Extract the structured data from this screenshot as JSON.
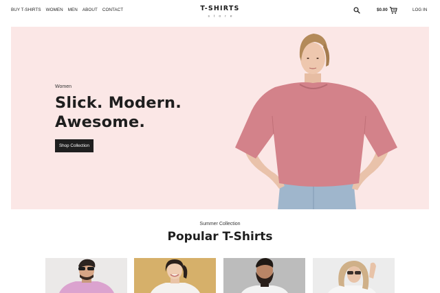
{
  "nav": {
    "items": [
      "BUY T-SHIRTS",
      "WOMEN",
      "MEN",
      "ABOUT",
      "CONTACT"
    ]
  },
  "brand": {
    "name": "T-SHIRTS",
    "tagline": "store"
  },
  "header": {
    "cart_total": "$0.00",
    "login_label": "LOG IN",
    "icons": [
      "search-icon",
      "cart-icon"
    ]
  },
  "hero": {
    "kicker": "Women",
    "title_line1": "Slick. Modern.",
    "title_line2": "Awesome.",
    "button_label": "Shop Collection",
    "background_color": "#fbe7e6"
  },
  "section": {
    "kicker": "Summer Collection",
    "title": "Popular T-Shirts"
  },
  "products": [
    {
      "image": "man-pink-tshirt-sunglasses"
    },
    {
      "image": "woman-white-tshirt-yellow-bg"
    },
    {
      "image": "bearded-man-white-tshirt"
    },
    {
      "image": "woman-sunglasses-white-tshirt"
    }
  ]
}
